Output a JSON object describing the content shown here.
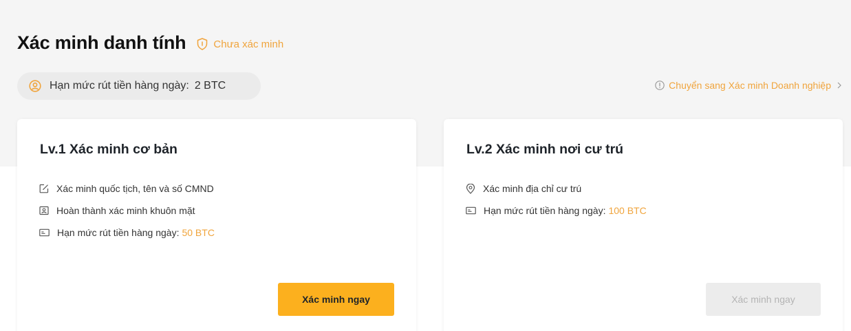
{
  "header": {
    "title": "Xác minh danh tính",
    "status_label": "Chưa xác minh"
  },
  "limit": {
    "label": "Hạn mức rút tiền hàng ngày:",
    "value": "2 BTC"
  },
  "switch_link": {
    "label": "Chuyển sang Xác minh Doanh nghiệp"
  },
  "cards": [
    {
      "title": "Lv.1 Xác minh cơ bản",
      "features": [
        {
          "icon": "edit-icon",
          "text": "Xác minh quốc tịch, tên và số CMND",
          "highlight": ""
        },
        {
          "icon": "face-id-icon",
          "text": "Hoàn thành xác minh khuôn mặt",
          "highlight": ""
        },
        {
          "icon": "card-icon",
          "text": "Hạn mức rút tiền hàng ngày:",
          "highlight": "50 BTC"
        }
      ],
      "button_label": "Xác minh ngay",
      "button_enabled": true
    },
    {
      "title": "Lv.2 Xác minh nơi cư trú",
      "features": [
        {
          "icon": "location-icon",
          "text": "Xác minh địa chỉ cư trú",
          "highlight": ""
        },
        {
          "icon": "card-icon",
          "text": "Hạn mức rút tiền hàng ngày:",
          "highlight": "100 BTC"
        }
      ],
      "button_label": "Xác minh ngay",
      "button_enabled": false
    }
  ],
  "colors": {
    "accent": "#f0a43c",
    "button_primary": "#fcb01e",
    "button_disabled": "#ececec",
    "band_bg": "#f5f5f5"
  }
}
